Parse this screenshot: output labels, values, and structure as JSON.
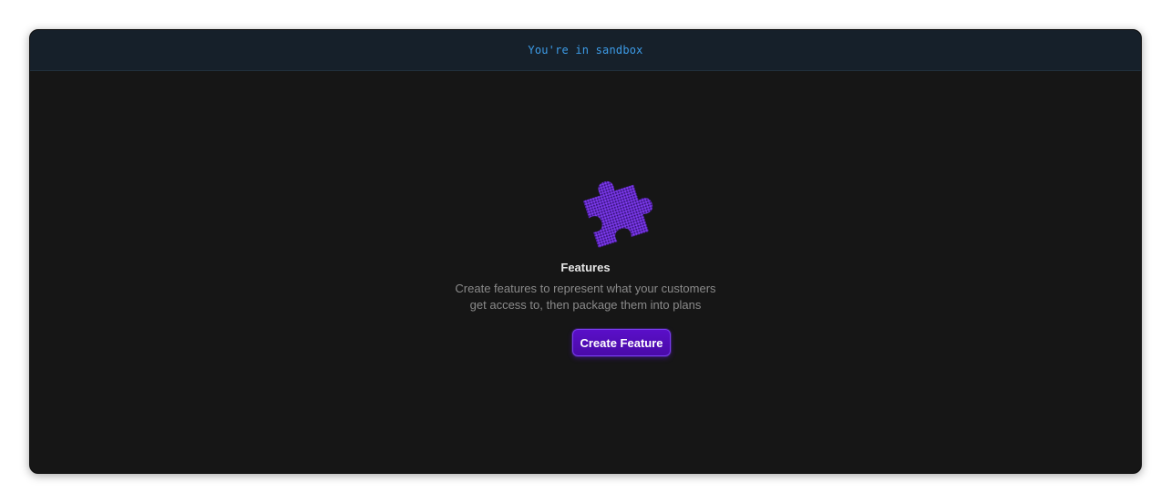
{
  "banner": {
    "text": "You're in sandbox",
    "color": "#3d9ce8"
  },
  "empty_state": {
    "illustration": "puzzle-piece-icon",
    "title": "Features",
    "description_line1": "Create features to represent what your customers",
    "description_line2": "get access to, then package them into plans",
    "button_label": "Create Feature"
  },
  "colors": {
    "background": "#161616",
    "banner_background": "#16202a",
    "accent": "#5a0fc8",
    "puzzle_light": "#8e44ff",
    "puzzle_dark": "#4a1a9a"
  }
}
